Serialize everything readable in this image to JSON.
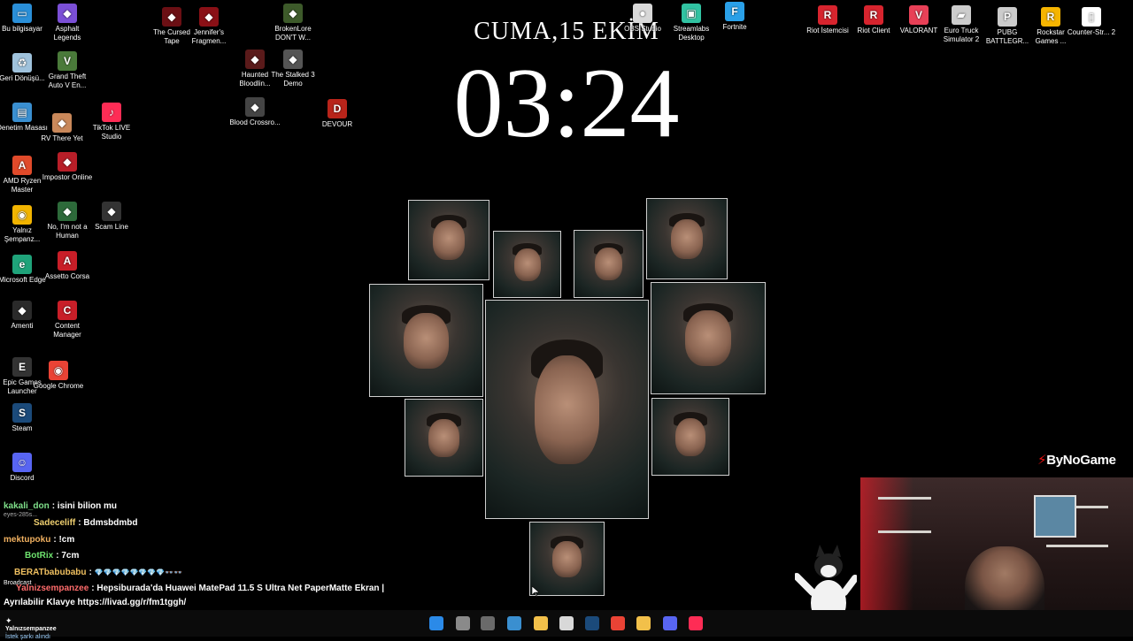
{
  "clock": {
    "date": "CUMA,15 EKİM",
    "time": "03:24"
  },
  "desktop_icons": [
    {
      "label": "Bu bilgisayar",
      "icon": "monitor-icon",
      "color": "#2a8fd8"
    },
    {
      "label": "Asphalt Legends",
      "icon": "game-icon",
      "color": "#7b4fd6"
    },
    {
      "label": "The Cursed Tape",
      "icon": "game-icon",
      "color": "#6b0f14"
    },
    {
      "label": "Jennifer's Fragmen...",
      "icon": "game-icon",
      "color": "#8a1016"
    },
    {
      "label": "BrokenLore DON'T W...",
      "icon": "game-icon",
      "color": "#3d5a2a"
    },
    {
      "label": "OBS Studio",
      "icon": "obs-icon",
      "color": "#d8d8d8"
    },
    {
      "label": "Streamlabs Desktop",
      "icon": "streamlabs-icon",
      "color": "#31c3a2"
    },
    {
      "label": "Fortnite",
      "icon": "fortnite-icon",
      "color": "#2aa0e8"
    },
    {
      "label": "Riot İstemcisi",
      "icon": "riot-icon",
      "color": "#d7242e"
    },
    {
      "label": "Riot Client",
      "icon": "riot-icon",
      "color": "#d7242e"
    },
    {
      "label": "VALORANT",
      "icon": "valorant-icon",
      "color": "#e84057"
    },
    {
      "label": "Euro Truck Simulator 2",
      "icon": "truck-icon",
      "color": "#cccccc"
    },
    {
      "label": "PUBG BATTLEGR...",
      "icon": "pubg-icon",
      "color": "#cccccc"
    },
    {
      "label": "Rockstar Games ...",
      "icon": "rockstar-icon",
      "color": "#f5b400"
    },
    {
      "label": "Counter-Str... 2",
      "icon": "file-icon",
      "color": "#ffffff"
    },
    {
      "label": "Geri Dönüşü...",
      "icon": "recycle-bin-icon",
      "color": "#9fc2dc"
    },
    {
      "label": "Grand Theft Auto V En...",
      "icon": "gta-icon",
      "color": "#4a7a3a"
    },
    {
      "label": "Haunted Bloodlin...",
      "icon": "game-icon",
      "color": "#5a1a1a"
    },
    {
      "label": "The Stalked 3 Demo",
      "icon": "game-icon",
      "color": "#555555"
    },
    {
      "label": "Denetim Masası",
      "icon": "control-panel-icon",
      "color": "#3a8fd0"
    },
    {
      "label": "RV There Yet",
      "icon": "game-icon",
      "color": "#c9885a"
    },
    {
      "label": "TikTok LIVE Studio",
      "icon": "tiktok-icon",
      "color": "#fe2c55"
    },
    {
      "label": "Blood Crossro...",
      "icon": "game-icon",
      "color": "#444444"
    },
    {
      "label": "DEVOUR",
      "icon": "devour-icon",
      "color": "#b8241a"
    },
    {
      "label": "AMD Ryzen Master",
      "icon": "amd-icon",
      "color": "#e04a2a"
    },
    {
      "label": "Impostor Online",
      "icon": "game-icon",
      "color": "#b81e28"
    },
    {
      "label": "Yalnız Şempanz...",
      "icon": "chrome-icon",
      "color": "#f2b400"
    },
    {
      "label": "No, I'm not a Human",
      "icon": "game-icon",
      "color": "#2d6a3a"
    },
    {
      "label": "Scam Line",
      "icon": "game-icon",
      "color": "#333333"
    },
    {
      "label": "Microsoft Edge",
      "icon": "edge-icon",
      "color": "#1fa37a"
    },
    {
      "label": "Assetto Corsa",
      "icon": "assetto-icon",
      "color": "#c81e28"
    },
    {
      "label": "Amenti",
      "icon": "game-icon",
      "color": "#2a2a2a"
    },
    {
      "label": "Content Manager",
      "icon": "content-manager-icon",
      "color": "#c81e28"
    },
    {
      "label": "Epic Games Launcher",
      "icon": "epic-icon",
      "color": "#333333"
    },
    {
      "label": "Google Chrome",
      "icon": "chrome-icon",
      "color": "#ea4335"
    },
    {
      "label": "Steam",
      "icon": "steam-icon",
      "color": "#1b4a7a"
    },
    {
      "label": "Discord",
      "icon": "discord-icon",
      "color": "#5865f2"
    }
  ],
  "chat": [
    {
      "user": "kakali_don",
      "message": ": isini bilion mu",
      "color": "#7fe08a"
    },
    {
      "user": "Sadeceliff",
      "message": ": Bdmsbdmbd",
      "color": "#f0d070"
    },
    {
      "user": "mektupoku",
      "message": ": !cm",
      "color": "#f0b060"
    },
    {
      "user": "BotRix",
      "message": ": 7cm",
      "color": "#6fe46f"
    },
    {
      "user": "BERATbabubabu",
      "message": ":",
      "color": "#f0c060"
    },
    {
      "user": "Yalnizsempanzee",
      "message": ": Hepsiburada'da Huawei MatePad 11.5 S Ultra Net PaperMatte Ekran |",
      "color": "#ff6b6b"
    },
    {
      "user": "",
      "message": "Ayrılabilir Klavye https://livad.gg/r/fm1tggh/",
      "color": "#ffffff"
    }
  ],
  "chat_extras": {
    "emotes": "💎💎💎💎💎💎💎💎👓👓",
    "overlay_small": "eyes-285s...",
    "broadcast": "Broadcast"
  },
  "branding": {
    "name": "ByNoGame"
  },
  "notification": {
    "title": "Yalnızsempanzee",
    "subtitle": "İstek şarkı alındı"
  },
  "taskbar": [
    {
      "icon": "windows-start-icon",
      "color": "#2b8ae8"
    },
    {
      "icon": "task-view-icon",
      "color": "#8a8a8a"
    },
    {
      "icon": "photos-icon",
      "color": "#6a6a6a"
    },
    {
      "icon": "gallery-icon",
      "color": "#3a8fd0"
    },
    {
      "icon": "file-explorer-icon",
      "color": "#f2c04a"
    },
    {
      "icon": "obs-icon",
      "color": "#d8d8d8"
    },
    {
      "icon": "steam-icon",
      "color": "#1b4a7a"
    },
    {
      "icon": "chrome-icon",
      "color": "#ea4335"
    },
    {
      "icon": "app-icon",
      "color": "#f2c04a"
    },
    {
      "icon": "discord-icon",
      "color": "#5865f2"
    },
    {
      "icon": "tiktok-icon",
      "color": "#fe2c55"
    }
  ]
}
